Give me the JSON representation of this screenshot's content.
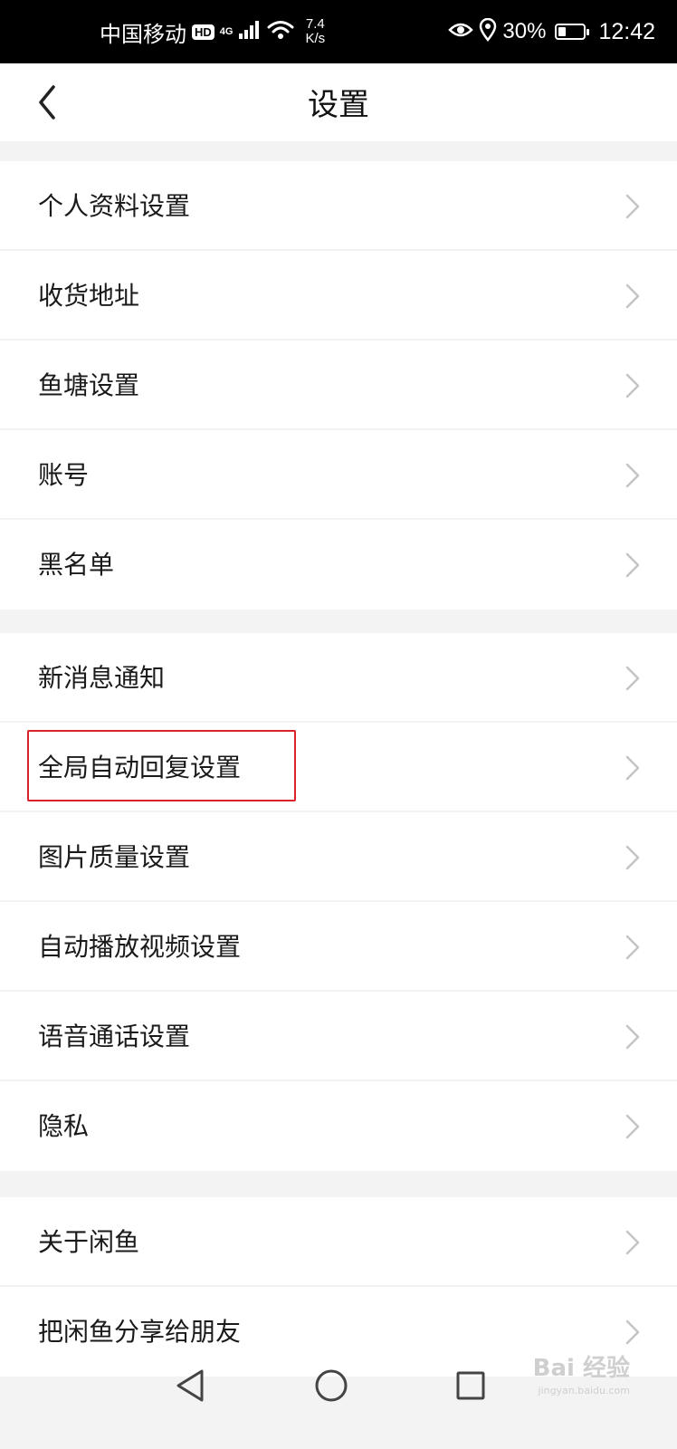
{
  "status_bar": {
    "carrier": "中国移动",
    "hd_badge": "HD",
    "network_type": "4G",
    "net_speed_value": "7.4",
    "net_speed_unit": "K/s",
    "battery_percent": "30%",
    "battery_level": 0.3,
    "time": "12:42",
    "icons": [
      "signal-icon",
      "wifi-icon",
      "eye-icon",
      "location-icon",
      "battery-icon"
    ]
  },
  "header": {
    "title": "设置",
    "back_icon": "chevron-left-icon"
  },
  "groups": [
    {
      "items": [
        {
          "label": "个人资料设置"
        },
        {
          "label": "收货地址"
        },
        {
          "label": "鱼塘设置"
        },
        {
          "label": "账号"
        },
        {
          "label": "黑名单"
        }
      ]
    },
    {
      "items": [
        {
          "label": "新消息通知"
        },
        {
          "label": "全局自动回复设置"
        },
        {
          "label": "图片质量设置"
        },
        {
          "label": "自动播放视频设置"
        },
        {
          "label": "语音通话设置"
        },
        {
          "label": "隐私"
        }
      ]
    },
    {
      "items": [
        {
          "label": "关于闲鱼"
        },
        {
          "label": "把闲鱼分享给朋友"
        }
      ]
    }
  ],
  "highlight_color": "#d9232b",
  "system_nav": {
    "icons": [
      "back-triangle-icon",
      "home-circle-icon",
      "recents-square-icon"
    ]
  },
  "watermark": {
    "text": "Bai 经验",
    "sub": "jingyan.baidu.com"
  }
}
